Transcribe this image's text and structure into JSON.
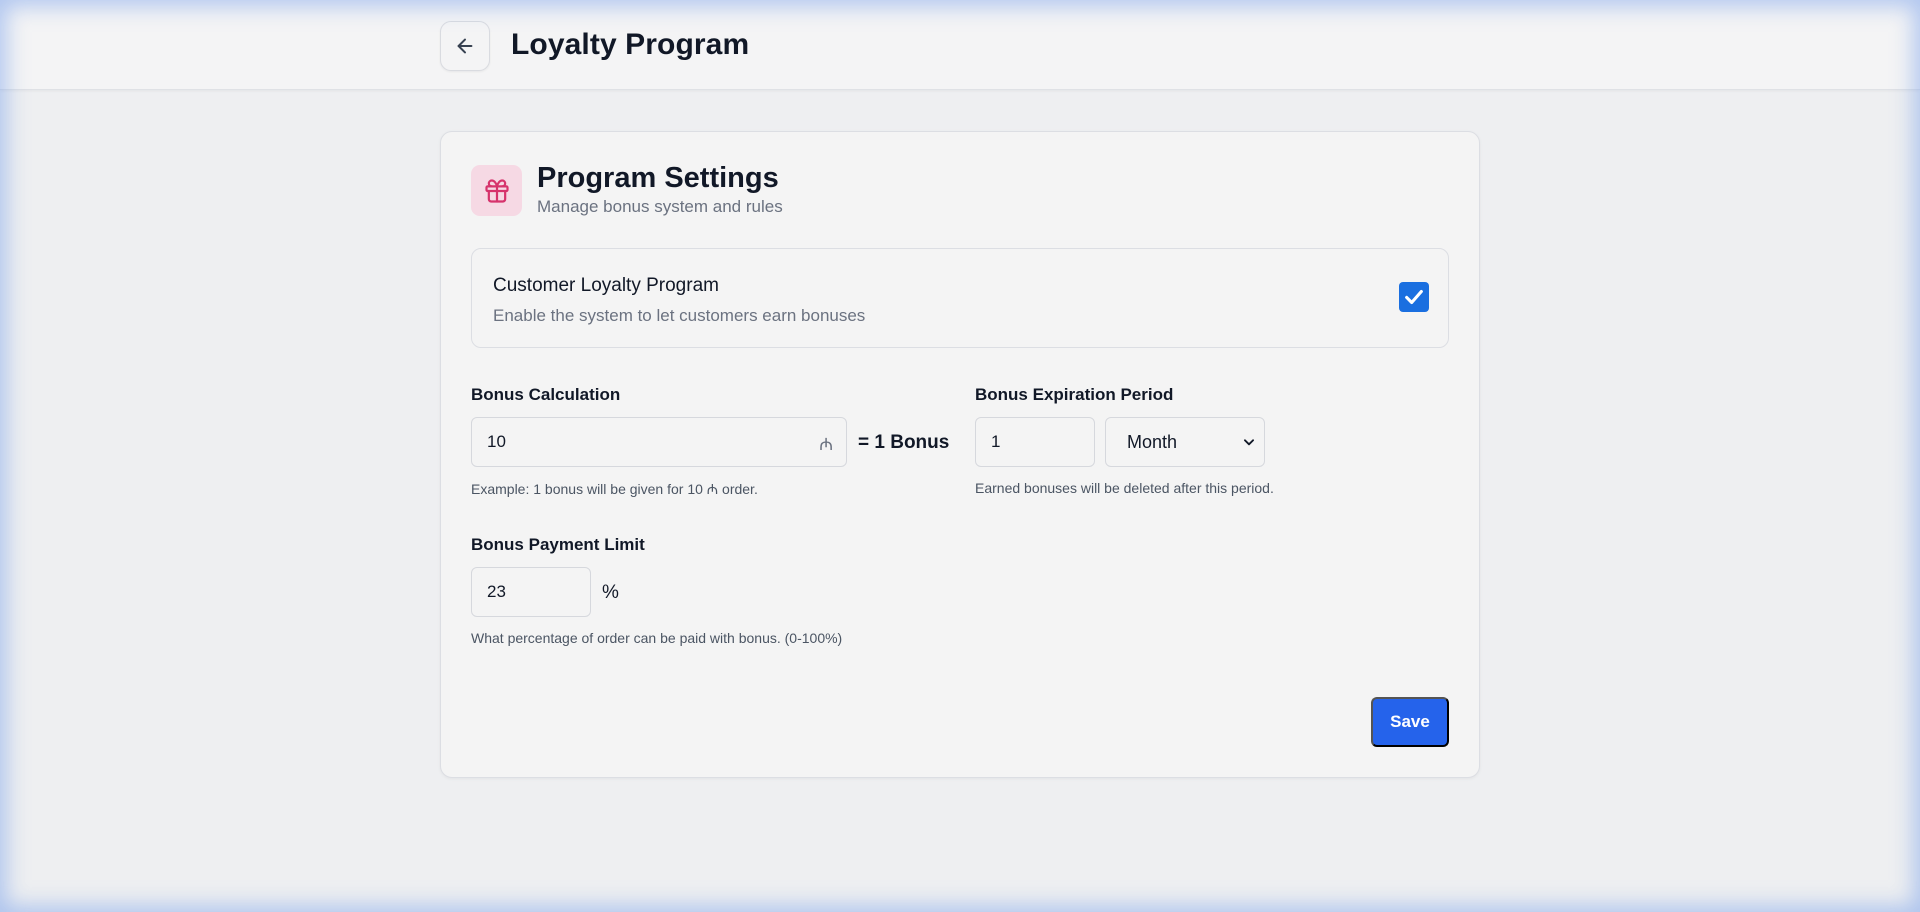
{
  "header": {
    "title": "Loyalty Program",
    "back_icon": "arrow-left-icon"
  },
  "settings": {
    "icon": "gift-icon",
    "title": "Program Settings",
    "subtitle": "Manage bonus system and rules",
    "loyalty": {
      "title": "Customer Loyalty Program",
      "description": "Enable the system to let customers earn bonuses",
      "enabled": true
    },
    "bonus_calc": {
      "label": "Bonus Calculation",
      "value": "10",
      "currency": "₼",
      "equals_text": "= 1 Bonus",
      "hint": "Example: 1 bonus will be given for 10 ₼ order."
    },
    "expiration": {
      "label": "Bonus Expiration Period",
      "value": "1",
      "unit": "Month",
      "hint": "Earned bonuses will be deleted after this period."
    },
    "payment_limit": {
      "label": "Bonus Payment Limit",
      "value": "23",
      "unit": "%",
      "hint": "What percentage of order can be paid with bonus. (0-100%)"
    },
    "save_label": "Save"
  },
  "colors": {
    "accent": "#2563eb",
    "checkbox": "#1a6fe0",
    "gift_bg": "#f6d9e4",
    "gift_icon": "#d6336c"
  }
}
